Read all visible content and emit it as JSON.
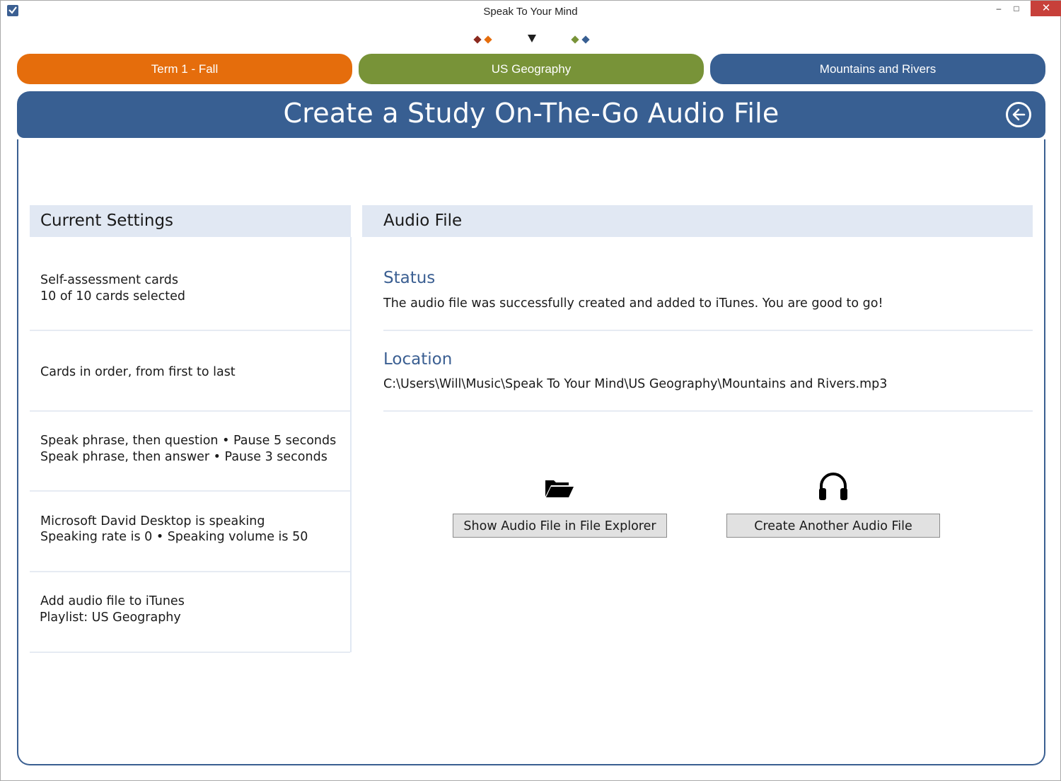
{
  "window": {
    "title": "Speak To Your Mind",
    "app_icon": "checkmark-app-icon",
    "minimize_glyph": "–",
    "maximize_glyph": "□",
    "close_glyph": "✕"
  },
  "colors": {
    "term": "#e56d0c",
    "subject": "#789338",
    "topic": "#385f92",
    "header": "#385f92",
    "panel_head_bg": "#e1e8f3",
    "accent_text": "#3b5f92",
    "diamond_dark_red": "#8b2a1f",
    "diamond_orange": "#e56d0c",
    "diamond_green": "#789338",
    "diamond_blue": "#385f92"
  },
  "breadcrumbs": {
    "term": "Term 1 - Fall",
    "subject": "US Geography",
    "topic": "Mountains and Rivers"
  },
  "header": {
    "title": "Create a Study On-The-Go Audio File",
    "back_icon": "back-arrow-icon"
  },
  "current_settings": {
    "heading": "Current Settings",
    "rows": [
      {
        "line1": "Self-assessment cards",
        "line2": "10 of 10 cards selected"
      },
      {
        "line1": "Cards in order, from first to last",
        "line2": ""
      },
      {
        "line1": "Speak phrase, then question  •  Pause 5 seconds",
        "line2": "Speak phrase, then answer  •  Pause 3 seconds"
      },
      {
        "line1": "Microsoft David Desktop is speaking",
        "line2": "Speaking rate is 0  •  Speaking volume is 50"
      },
      {
        "line1": "Add audio file to iTunes",
        "line2": "Playlist: US Geography"
      }
    ]
  },
  "audio_file": {
    "heading": "Audio File",
    "status_title": "Status",
    "status_text": "The audio file was successfully created and added to iTunes.  You are good to go!",
    "location_title": "Location",
    "location_text": "C:\\Users\\Will\\Music\\Speak To Your Mind\\US Geography\\Mountains and Rivers.mp3",
    "actions": {
      "show_label": "Show Audio File in File Explorer",
      "show_icon": "open-folder-icon",
      "another_label": "Create Another Audio File",
      "another_icon": "headphones-icon"
    }
  }
}
